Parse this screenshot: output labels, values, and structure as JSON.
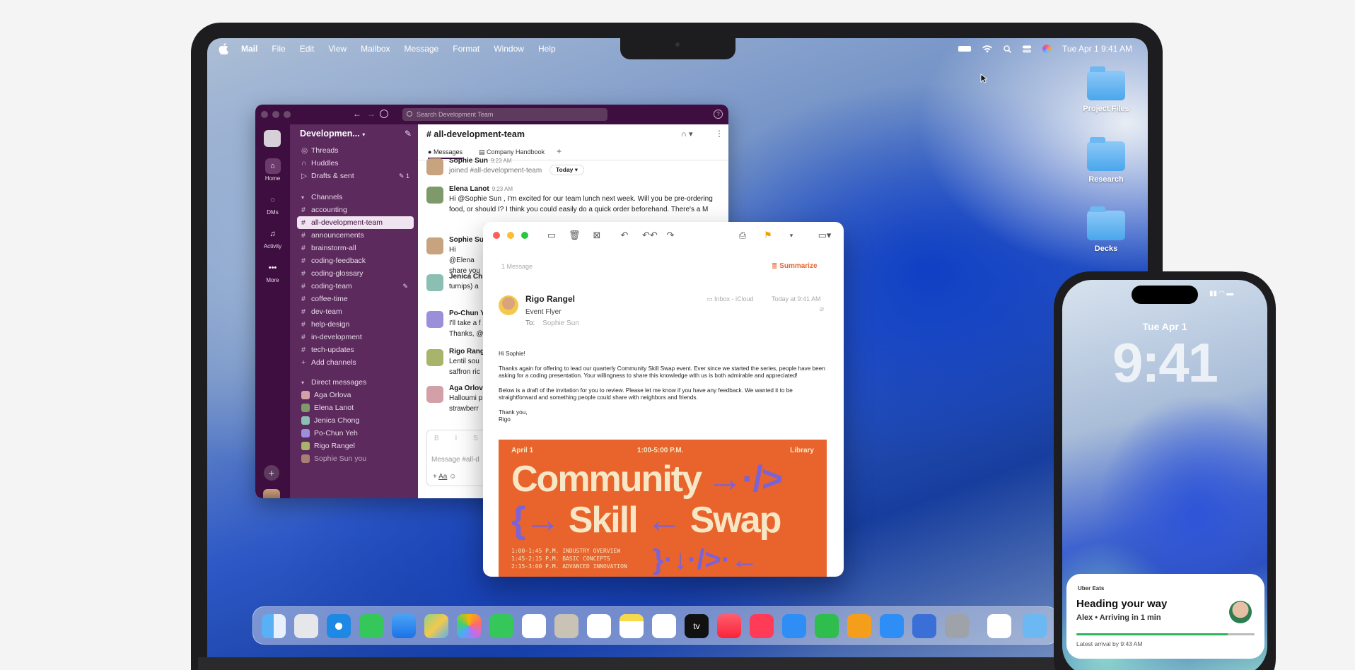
{
  "menubar": {
    "app": "Mail",
    "items": [
      "File",
      "Edit",
      "View",
      "Mailbox",
      "Message",
      "Format",
      "Window",
      "Help"
    ],
    "clock": "Tue Apr 1  9:41 AM"
  },
  "desktop": {
    "folders": [
      "Project Files",
      "Research",
      "Decks"
    ]
  },
  "slack": {
    "search_placeholder": "Search Development Team",
    "workspace": "Developmen...",
    "rail": [
      "Home",
      "DMs",
      "Activity",
      "More"
    ],
    "nav": {
      "threads": "Threads",
      "huddles": "Huddles",
      "drafts": "Drafts & sent",
      "drafts_count": "1"
    },
    "channels_header": "Channels",
    "channels": [
      "accounting",
      "all-development-team",
      "announcements",
      "brainstorm-all",
      "coding-feedback",
      "coding-glossary",
      "coding-team",
      "coffee-time",
      "dev-team",
      "help-design",
      "in-development",
      "tech-updates"
    ],
    "add_channels": "Add channels",
    "dms_header": "Direct messages",
    "dms": [
      "Aga Orlova",
      "Elena Lanot",
      "Jenica Chong",
      "Po-Chun Yeh",
      "Rigo Rangel",
      "Sophie Sun  you"
    ],
    "channel_title": "# all-development-team",
    "tabs": [
      "Messages",
      "Company Handbook"
    ],
    "date_chip": "Today",
    "messages": [
      {
        "name": "Sophie Sun",
        "time": "9:23 AM",
        "text": "joined #all-development-team"
      },
      {
        "name": "Elena Lanot",
        "time": "9:23 AM",
        "text": "Hi @Sophie Sun , I'm excited for our team lunch next week. Will you be pre-ordering food, or should I? I think you could easily do a quick order beforehand. There's a M"
      },
      {
        "name": "Sophie Su",
        "time": "",
        "text": "Hi @Elena share you"
      },
      {
        "name": "Jenica Ch",
        "time": "",
        "text": "turnips) a"
      },
      {
        "name": "Po-Chun Y",
        "time": "",
        "text": "I'll take a f Thanks, @"
      },
      {
        "name": "Rigo Rang",
        "time": "",
        "text": "Lentil sou saffron ric"
      },
      {
        "name": "Aga Orlov",
        "time": "",
        "text": "Halloumi p strawberr"
      }
    ],
    "composer_placeholder": "Message #all-d"
  },
  "mail": {
    "count": "1 Message",
    "summarize": "Summarize",
    "sender": "Rigo Rangel",
    "subject": "Event Flyer",
    "to_label": "To:",
    "to": "Sophie Sun",
    "mailbox": "Inbox - iCloud",
    "date": "Today at 9:41 AM",
    "body": [
      "Hi Sophie!",
      "Thanks again for offering to lead our quarterly Community Skill Swap event. Ever since we started the series, people have been asking for a coding presentation. Your willingness to share this knowledge with us is both admirable and appreciated!",
      "Below is a draft of the invitation for you to review. Please let me know if you have any feedback. We wanted it to be straightforward and something people could share with neighbors and friends.",
      "Thank you,",
      "Rigo"
    ],
    "poster": {
      "date": "April 1",
      "time": "1:00-5:00 P.M.",
      "place": "Library",
      "line1": "Community",
      "line2": "Skill",
      "line3": "Swap",
      "schedule": [
        "1:00-1:45 P.M. INDUSTRY OVERVIEW",
        "1:45-2:15 P.M. BASIC CONCEPTS",
        "2:15-3:00 P.M. ADVANCED INNOVATION"
      ]
    }
  },
  "dock": {
    "tv_label": "tv"
  },
  "phone": {
    "date": "Tue Apr 1",
    "time": "9:41",
    "live": {
      "app": "Uber Eats",
      "title": "Heading your way",
      "subtitle": "Alex • Arriving in 1 min",
      "footer": "Latest arrival by 9:43 AM",
      "progress": 0.85
    }
  },
  "colors": {
    "slack_aubergine": "#3f0e40",
    "poster_orange": "#e8642c",
    "summarize": "#e8642c"
  }
}
